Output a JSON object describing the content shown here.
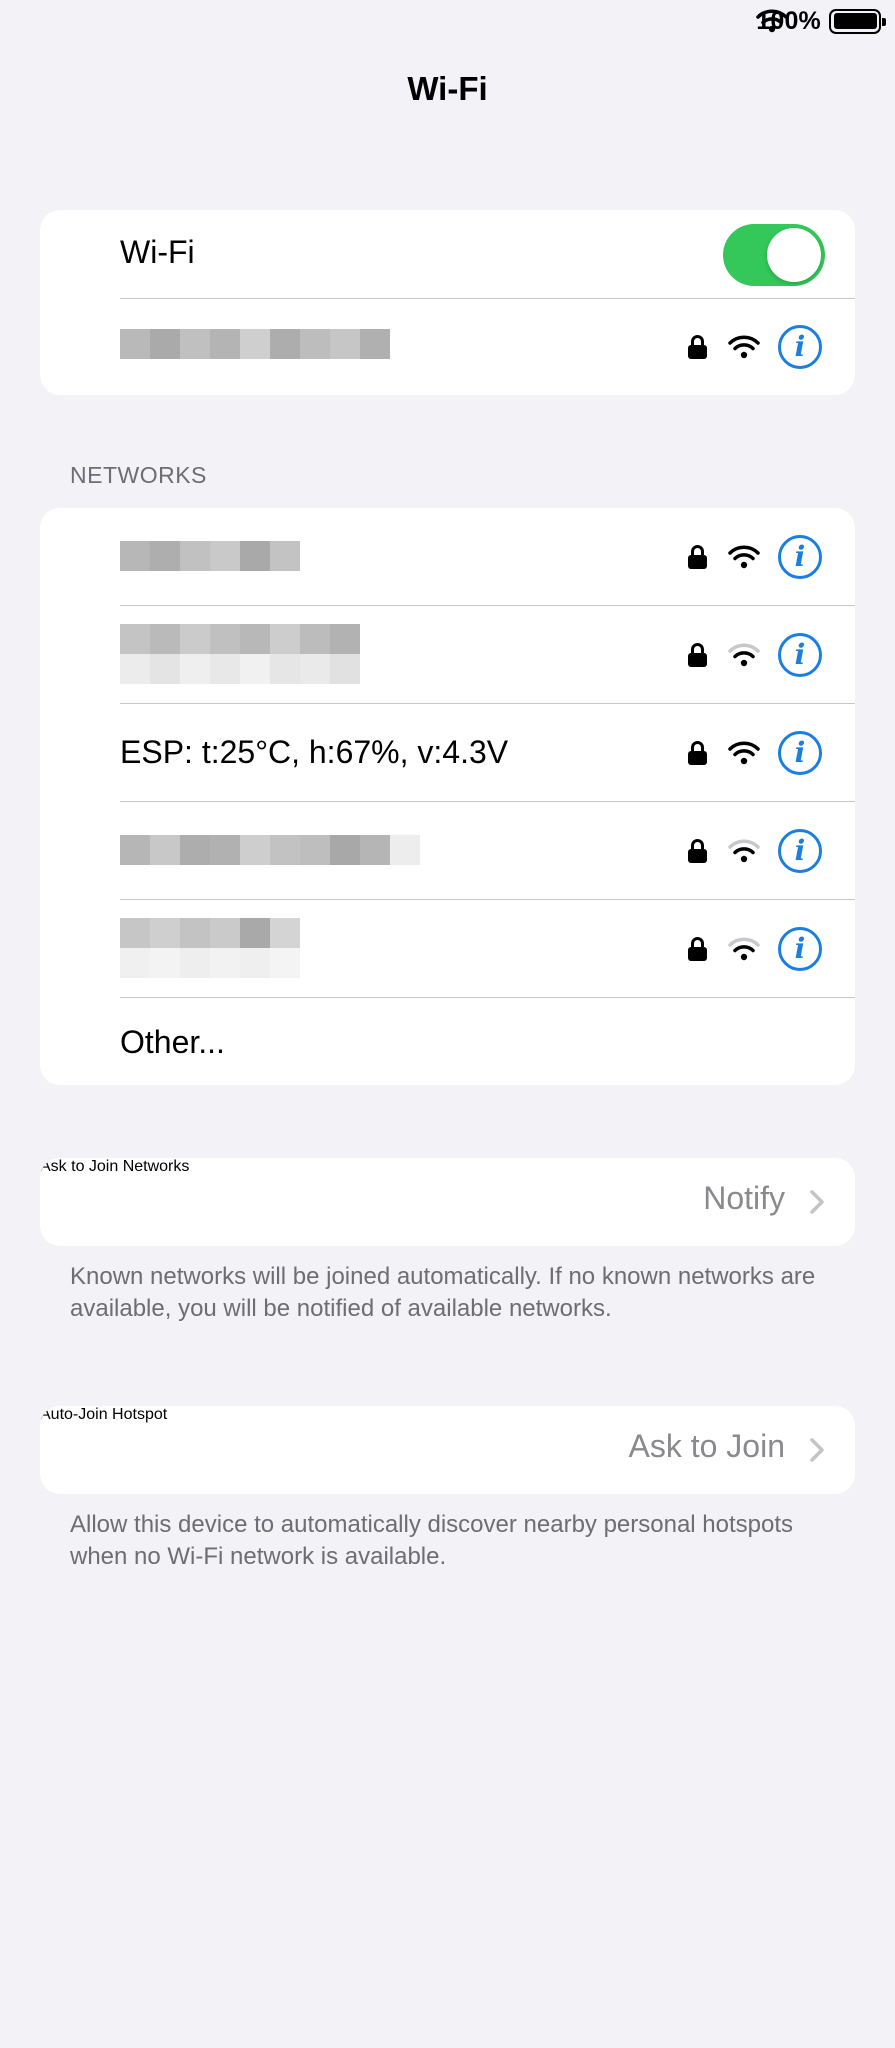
{
  "status_bar": {
    "battery": "100%",
    "wifi_icon": "wifi-icon",
    "battery_icon": "battery-icon"
  },
  "nav": {
    "title": "Wi-Fi"
  },
  "wifi_section": {
    "toggle_label": "Wi-Fi",
    "toggle_on": true,
    "connected_network": {
      "name_redacted": true,
      "locked": true,
      "signal": "full"
    }
  },
  "networks": {
    "header": "NETWORKS",
    "items": [
      {
        "name": "",
        "redacted": true,
        "locked": true,
        "signal": "full"
      },
      {
        "name": "",
        "redacted": true,
        "locked": true,
        "signal": "weak"
      },
      {
        "name": "ESP: t:25°C, h:67%, v:4.3V",
        "redacted": false,
        "locked": true,
        "signal": "full"
      },
      {
        "name": "",
        "redacted": true,
        "locked": true,
        "signal": "weak"
      },
      {
        "name": "",
        "redacted": true,
        "locked": true,
        "signal": "weak"
      }
    ],
    "other_label": "Other..."
  },
  "ask_to_join": {
    "label": "Ask to Join Networks",
    "value": "Notify",
    "footnote": "Known networks will be joined automatically. If no known networks are available, you will be notified of available networks."
  },
  "auto_join": {
    "label": "Auto-Join Hotspot",
    "value": "Ask to Join",
    "footnote": "Allow this device to automatically discover nearby personal hotspots when no Wi-Fi network is available."
  },
  "colors": {
    "accent": "#1a7fe0",
    "toggle_on": "#34c759",
    "background": "#f2f2f7",
    "weak_signal": "#c7c7cc"
  }
}
